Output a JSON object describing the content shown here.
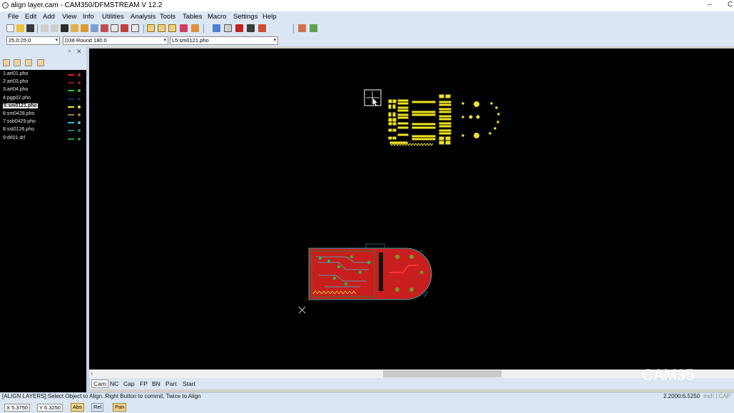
{
  "window": {
    "title": "align layer.cam - CAM350/DFMSTREAM V 12.2",
    "minimize": "–",
    "close": "C"
  },
  "menu": [
    "File",
    "Edit",
    "Add",
    "View",
    "Info",
    "Utilities",
    "Analysis",
    "Tools",
    "Tables",
    "Macro",
    "Settings",
    "Help"
  ],
  "toolbar2": {
    "grid_value": "25.0:25.0",
    "dcode_value": "D38  Round 180.0",
    "layer_value": "L5:sm0121.pho"
  },
  "layer_panel": {
    "pin": "ᵖ",
    "close": "✕",
    "layers": [
      {
        "label": "1:art01.pho",
        "color": "#d81e1e"
      },
      {
        "label": "2:art03.pho",
        "color": "#8e1a1a"
      },
      {
        "label": "3:art04.pho",
        "color": "#22c83a"
      },
      {
        "label": "4:pgp02.pho",
        "color": "#17286e"
      },
      {
        "label": "5:sm0121.pho",
        "color": "#f0e31e"
      },
      {
        "label": "6:sm0428.pho",
        "color": "#9a8a1e"
      },
      {
        "label": "7:ssb0429.pho",
        "color": "#28c8d8"
      },
      {
        "label": "8:sst0126.pho",
        "color": "#1e7a7a"
      },
      {
        "label": "9:drl01.drl",
        "color": "#1e9a3a"
      }
    ],
    "active_index": 4
  },
  "tabs": [
    "Cam",
    "NC",
    "Cap",
    "FP",
    "BN",
    "Part",
    "Start"
  ],
  "status": {
    "message": "[ALIGN LAYERS]:Select Object to Align..Right Button to commit, Twice to Align",
    "coords": "2.2000:6.5250",
    "unit": "Inch",
    "cap": "CAP"
  },
  "bottom": {
    "x_label": "X",
    "x_value": "5.3750",
    "y_label": "Y",
    "y_value": "6.3250",
    "abs": "Abs",
    "rel": "Rel",
    "pan": "Pan"
  },
  "watermark": "CAM35"
}
